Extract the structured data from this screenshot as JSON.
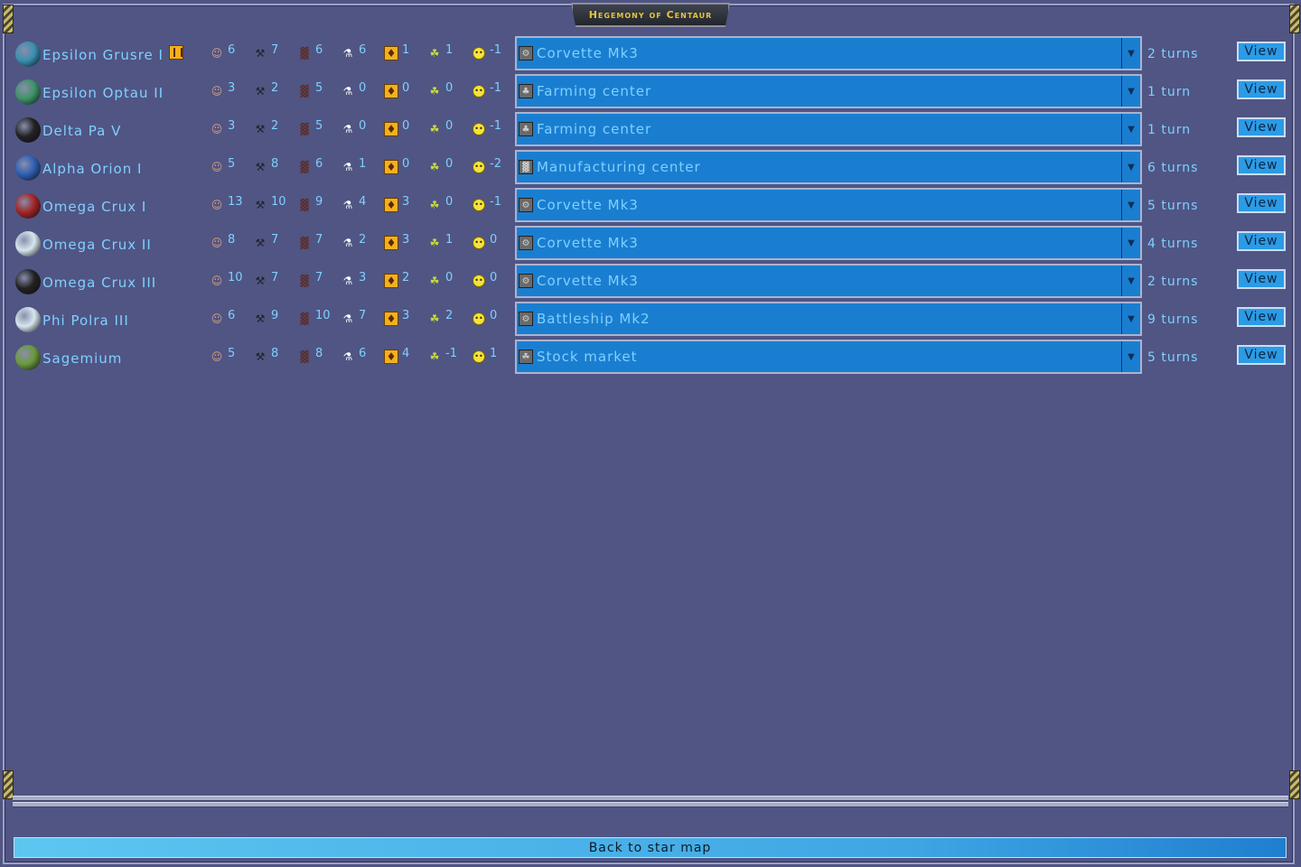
{
  "window": {
    "title": "Hegemony of Centaur"
  },
  "colonies": [
    {
      "name": "Epsilon Grusre I",
      "capital": true,
      "planet_color": "#3a8fb0",
      "population": "6",
      "industry": "7",
      "factories": "6",
      "science": "6",
      "defense": "1",
      "income": "1",
      "morale": "-1",
      "production": "Corvette Mk3",
      "production_icon": "ship-icon",
      "turns": "2 turns"
    },
    {
      "name": "Epsilon Optau II",
      "capital": false,
      "planet_color": "#3d9466",
      "population": "3",
      "industry": "2",
      "factories": "5",
      "science": "0",
      "defense": "0",
      "income": "0",
      "morale": "-1",
      "production": "Farming center",
      "production_icon": "farm-icon",
      "turns": "1 turn"
    },
    {
      "name": "Delta Pa V",
      "capital": false,
      "planet_color": "#222222",
      "population": "3",
      "industry": "2",
      "factories": "5",
      "science": "0",
      "defense": "0",
      "income": "0",
      "morale": "-1",
      "production": "Farming center",
      "production_icon": "farm-icon",
      "turns": "1 turn"
    },
    {
      "name": "Alpha Orion I",
      "capital": false,
      "planet_color": "#2d5fb0",
      "population": "5",
      "industry": "8",
      "factories": "6",
      "science": "1",
      "defense": "0",
      "income": "0",
      "morale": "-2",
      "production": "Manufacturing center",
      "production_icon": "factory-icon",
      "turns": "6 turns"
    },
    {
      "name": "Omega Crux I",
      "capital": false,
      "planet_color": "#a02525",
      "population": "13",
      "industry": "10",
      "factories": "9",
      "science": "4",
      "defense": "3",
      "income": "0",
      "morale": "-1",
      "production": "Corvette Mk3",
      "production_icon": "ship-icon",
      "turns": "5 turns"
    },
    {
      "name": "Omega Crux II",
      "capital": false,
      "planet_color": "#d6e6ee",
      "population": "8",
      "industry": "7",
      "factories": "7",
      "science": "2",
      "defense": "3",
      "income": "1",
      "morale": "0",
      "production": "Corvette Mk3",
      "production_icon": "ship-icon",
      "turns": "4 turns"
    },
    {
      "name": "Omega Crux III",
      "capital": false,
      "planet_color": "#222222",
      "population": "10",
      "industry": "7",
      "factories": "7",
      "science": "3",
      "defense": "2",
      "income": "0",
      "morale": "0",
      "production": "Corvette Mk3",
      "production_icon": "ship-icon",
      "turns": "2 turns"
    },
    {
      "name": "Phi Polra III",
      "capital": false,
      "planet_color": "#d6e6ee",
      "population": "6",
      "industry": "9",
      "factories": "10",
      "science": "7",
      "defense": "3",
      "income": "2",
      "morale": "0",
      "production": "Battleship Mk2",
      "production_icon": "ship-icon",
      "turns": "9 turns"
    },
    {
      "name": "Sagemium",
      "capital": false,
      "planet_color": "#6a9a3a",
      "population": "5",
      "industry": "8",
      "factories": "8",
      "science": "6",
      "defense": "4",
      "income": "-1",
      "morale": "1",
      "production": "Stock market",
      "production_icon": "income-icon",
      "turns": "5 turns"
    }
  ],
  "labels": {
    "view": "View",
    "back": "Back to star map"
  }
}
